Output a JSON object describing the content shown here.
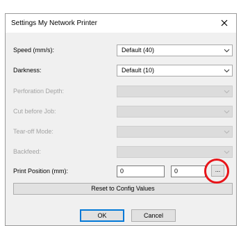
{
  "window": {
    "title": "Settings My Network Printer"
  },
  "rows": [
    {
      "label": "Speed (mm/s):",
      "value": "Default (40)",
      "enabled": true
    },
    {
      "label": "Darkness:",
      "value": "Default (10)",
      "enabled": true
    },
    {
      "label": "Perforation Depth:",
      "value": "",
      "enabled": false
    },
    {
      "label": "Cut before Job:",
      "value": "",
      "enabled": false
    },
    {
      "label": "Tear-off Mode:",
      "value": "",
      "enabled": false
    },
    {
      "label": "Backfeed:",
      "value": "",
      "enabled": false
    }
  ],
  "print_position": {
    "label": "Print Position (mm):",
    "x_value": "0",
    "y_value": "0",
    "browse_label": "..."
  },
  "reset_button": {
    "label": "Reset to Config Values"
  },
  "ok_button": {
    "label": "OK"
  },
  "cancel_button": {
    "label": "Cancel"
  },
  "colors": {
    "highlight_ring": "#e8151a",
    "default_button_border": "#0078d7"
  }
}
